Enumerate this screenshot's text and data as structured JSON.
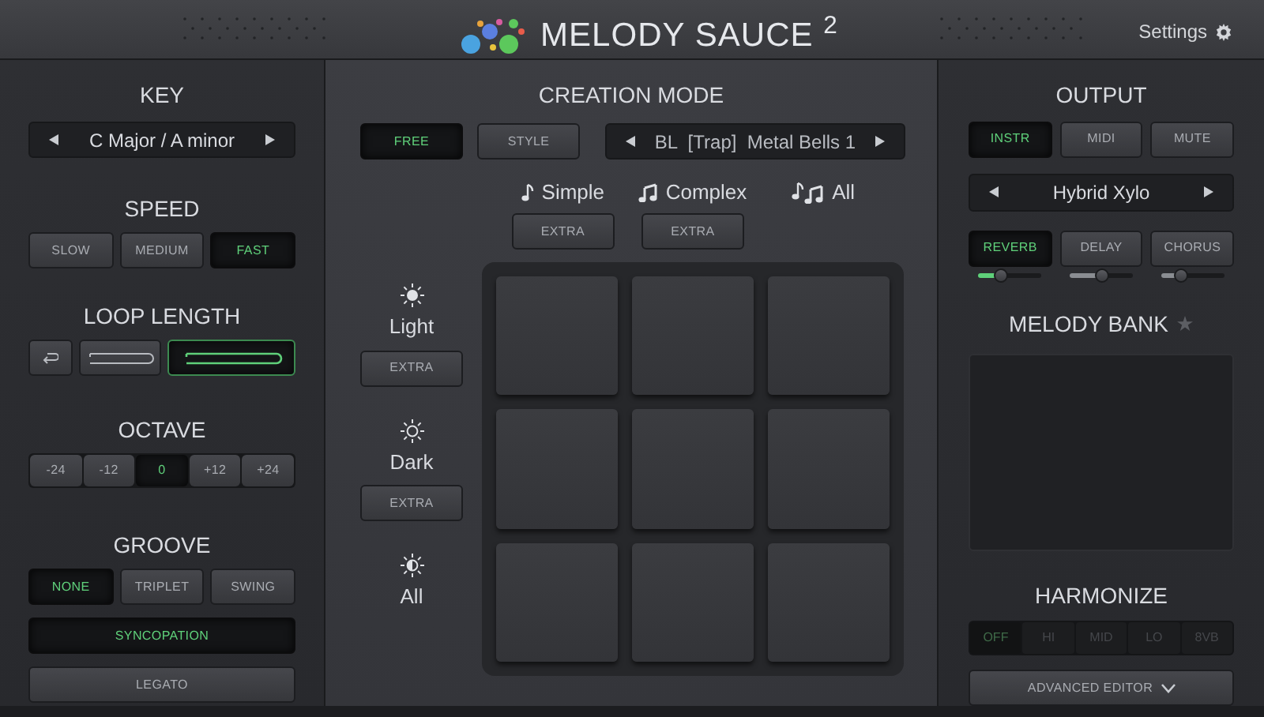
{
  "header": {
    "title": "MELODY SAUCE",
    "title_sup": "2",
    "settings": "Settings"
  },
  "left": {
    "key": {
      "heading": "KEY",
      "value": "C Major / A minor"
    },
    "speed": {
      "heading": "SPEED",
      "options": [
        {
          "label": "SLOW",
          "selected": false
        },
        {
          "label": "MEDIUM",
          "selected": false
        },
        {
          "label": "FAST",
          "selected": true
        }
      ]
    },
    "loop_length": {
      "heading": "LOOP LENGTH",
      "options": [
        {
          "kind": "undo",
          "selected": false
        },
        {
          "kind": "short",
          "selected": false
        },
        {
          "kind": "long",
          "selected": true
        }
      ]
    },
    "octave": {
      "heading": "OCTAVE",
      "options": [
        {
          "label": "-24",
          "selected": false
        },
        {
          "label": "-12",
          "selected": false
        },
        {
          "label": "0",
          "selected": true
        },
        {
          "label": "+12",
          "selected": false
        },
        {
          "label": "+24",
          "selected": false
        }
      ]
    },
    "groove": {
      "heading": "GROOVE",
      "options": [
        {
          "label": "NONE",
          "selected": true
        },
        {
          "label": "TRIPLET",
          "selected": false
        },
        {
          "label": "SWING",
          "selected": false
        }
      ],
      "syncopation": {
        "label": "SYNCOPATION",
        "on": true
      },
      "legato": {
        "label": "LEGATO",
        "on": false
      }
    }
  },
  "center": {
    "heading": "CREATION MODE",
    "modes": [
      {
        "label": "FREE",
        "selected": true
      },
      {
        "label": "STYLE",
        "selected": false
      }
    ],
    "preset": "BL  [Trap]  Metal Bells 1",
    "complexity": [
      {
        "label": "Simple",
        "kind": "single",
        "extra": "EXTRA"
      },
      {
        "label": "Complex",
        "kind": "double",
        "extra": "EXTRA"
      },
      {
        "label": "All",
        "kind": "both"
      }
    ],
    "mood": [
      {
        "label": "Light",
        "kind": "light",
        "extra": "EXTRA"
      },
      {
        "label": "Dark",
        "kind": "dark",
        "extra": "EXTRA"
      },
      {
        "label": "All",
        "kind": "both"
      }
    ]
  },
  "right": {
    "output": {
      "heading": "OUTPUT",
      "options": [
        {
          "label": "INSTR",
          "selected": true
        },
        {
          "label": "MIDI",
          "selected": false
        },
        {
          "label": "MUTE",
          "selected": false
        }
      ],
      "instrument": "Hybrid Xylo",
      "effects": [
        {
          "label": "REVERB",
          "on": true,
          "level": 0.35
        },
        {
          "label": "DELAY",
          "on": false,
          "level": 0.5
        },
        {
          "label": "CHORUS",
          "on": false,
          "level": 0.3
        }
      ]
    },
    "melody_bank": {
      "heading": "MELODY BANK",
      "starred": false
    },
    "harmonize": {
      "heading": "HARMONIZE",
      "disabled": true,
      "options": [
        {
          "label": "OFF",
          "selected": true
        },
        {
          "label": "HI",
          "selected": false
        },
        {
          "label": "MID",
          "selected": false
        },
        {
          "label": "LO",
          "selected": false
        },
        {
          "label": "8VB",
          "selected": false
        }
      ]
    },
    "advanced_editor": "ADVANCED EDITOR"
  }
}
